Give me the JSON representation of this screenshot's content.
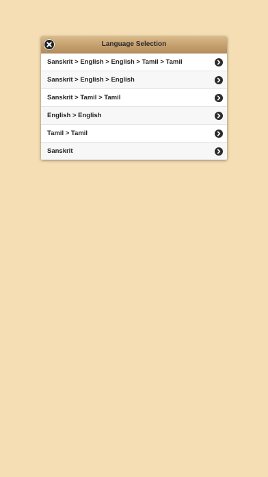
{
  "dialog": {
    "title": "Language Selection",
    "close_icon": "close-icon",
    "items": [
      {
        "label": "Sanskrit > English > English > Tamil > Tamil",
        "icon": "chevron-right-icon"
      },
      {
        "label": "Sanskrit > English > English",
        "icon": "chevron-right-icon"
      },
      {
        "label": "Sanskrit > Tamil > Tamil",
        "icon": "chevron-right-icon"
      },
      {
        "label": "English > English",
        "icon": "chevron-right-icon"
      },
      {
        "label": "Tamil > Tamil",
        "icon": "chevron-right-icon"
      },
      {
        "label": "Sanskrit",
        "icon": "chevron-right-icon"
      }
    ]
  },
  "colors": {
    "background": "#f5deb3",
    "header_top": "#d9b98a",
    "header_bottom": "#b58d5a",
    "icon_fill": "#2b2b2b"
  }
}
